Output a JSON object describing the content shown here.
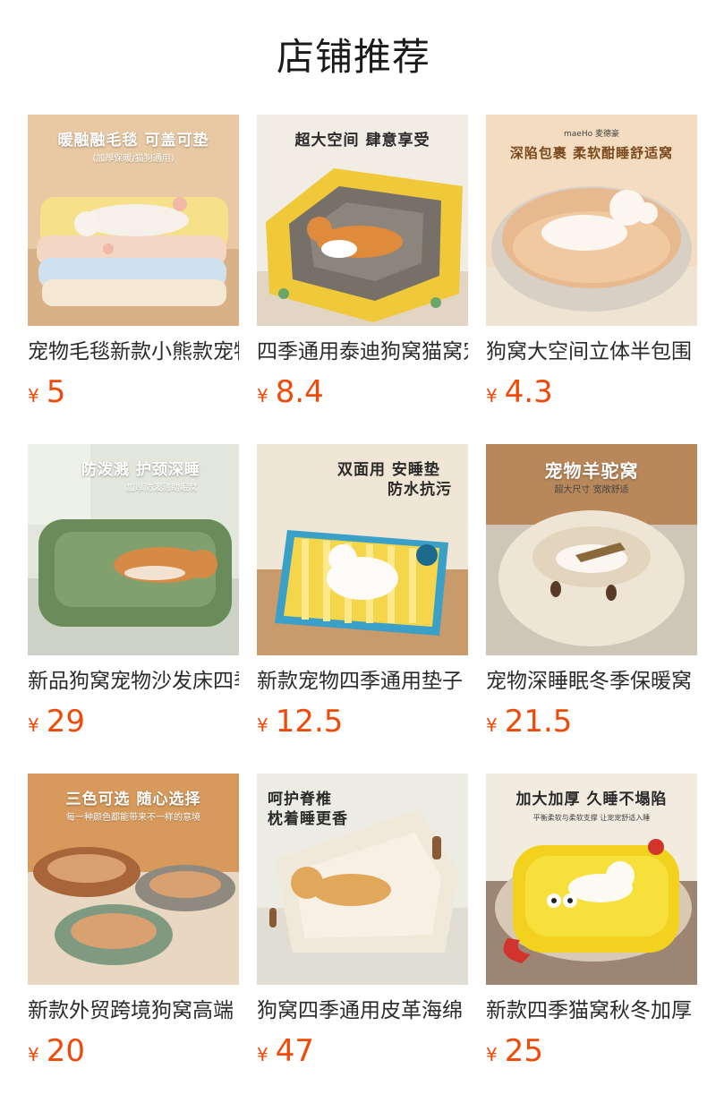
{
  "header": {
    "title": "店铺推荐"
  },
  "products": [
    {
      "name": "宠物毛毯新款小熊款宠物垫",
      "currency": "¥",
      "price": "5",
      "img_line1": "暖融融毛毯 可盖可垫",
      "img_line2": "(加厚保暖/猫狗通用)"
    },
    {
      "name": "四季通用泰迪狗窝猫窝宠物",
      "currency": "¥",
      "price": "8.4",
      "img_line1": "超大空间 肆意享受",
      "img_line2": ""
    },
    {
      "name": "狗窝大空间立体半包围",
      "currency": "¥",
      "price": "4.3",
      "img_line1": "深陷包裹 柔软酣睡舒适窝",
      "img_line2": "maeHo 麦德豪"
    },
    {
      "name": "新品狗窝宠物沙发床四季",
      "currency": "¥",
      "price": "29",
      "img_line1": "防泼溅 护颈深睡",
      "img_line2": "加厚防泼溅助眠窝"
    },
    {
      "name": "新款宠物四季通用垫子",
      "currency": "¥",
      "price": "12.5",
      "img_line1": "双面用 安睡垫",
      "img_line2": "防水抗污"
    },
    {
      "name": "宠物深睡眠冬季保暖窝",
      "currency": "¥",
      "price": "21.5",
      "img_line1": "宠物羊驼窝",
      "img_line2": "超大尺寸 宽敞舒适"
    },
    {
      "name": "新款外贸跨境狗窝高端",
      "currency": "¥",
      "price": "20",
      "img_line1": "三色可选 随心选择",
      "img_line2": "每一种颜色都能带来不一样的意境"
    },
    {
      "name": "狗窝四季通用皮革海绵",
      "currency": "¥",
      "price": "47",
      "img_line1": "呵护脊椎",
      "img_line2": "枕着睡更香"
    },
    {
      "name": "新款四季猫窝秋冬加厚",
      "currency": "¥",
      "price": "25",
      "img_line1": "加大加厚 久睡不塌陷",
      "img_line2": "平衡柔软与柔软支撑 让宠宠舒适入睡"
    }
  ]
}
